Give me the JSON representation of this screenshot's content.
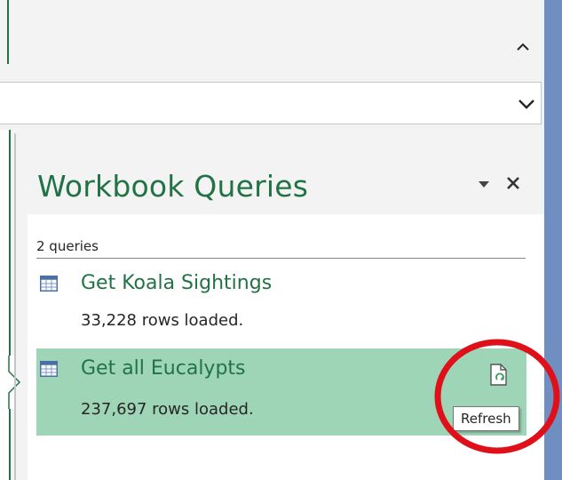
{
  "pane": {
    "title": "Workbook Queries",
    "query_count": "2 queries",
    "queries": [
      {
        "name": "Get Koala Sightings",
        "rows": "33,228 rows loaded.",
        "selected": false
      },
      {
        "name": "Get all Eucalypts",
        "rows": "237,697 rows loaded.",
        "selected": true
      }
    ],
    "tooltip": "Refresh"
  },
  "icons": {
    "collapse": "chevron-up-icon",
    "expand": "chevron-down-icon",
    "menu": "dropdown-arrow-icon",
    "close": "close-icon",
    "query": "table-icon",
    "refresh": "refresh-icon"
  },
  "colors": {
    "accent": "#217346",
    "selected_row": "#9fd5b7",
    "annotation": "#e0101a",
    "window_edge": "#6f8fc0"
  }
}
